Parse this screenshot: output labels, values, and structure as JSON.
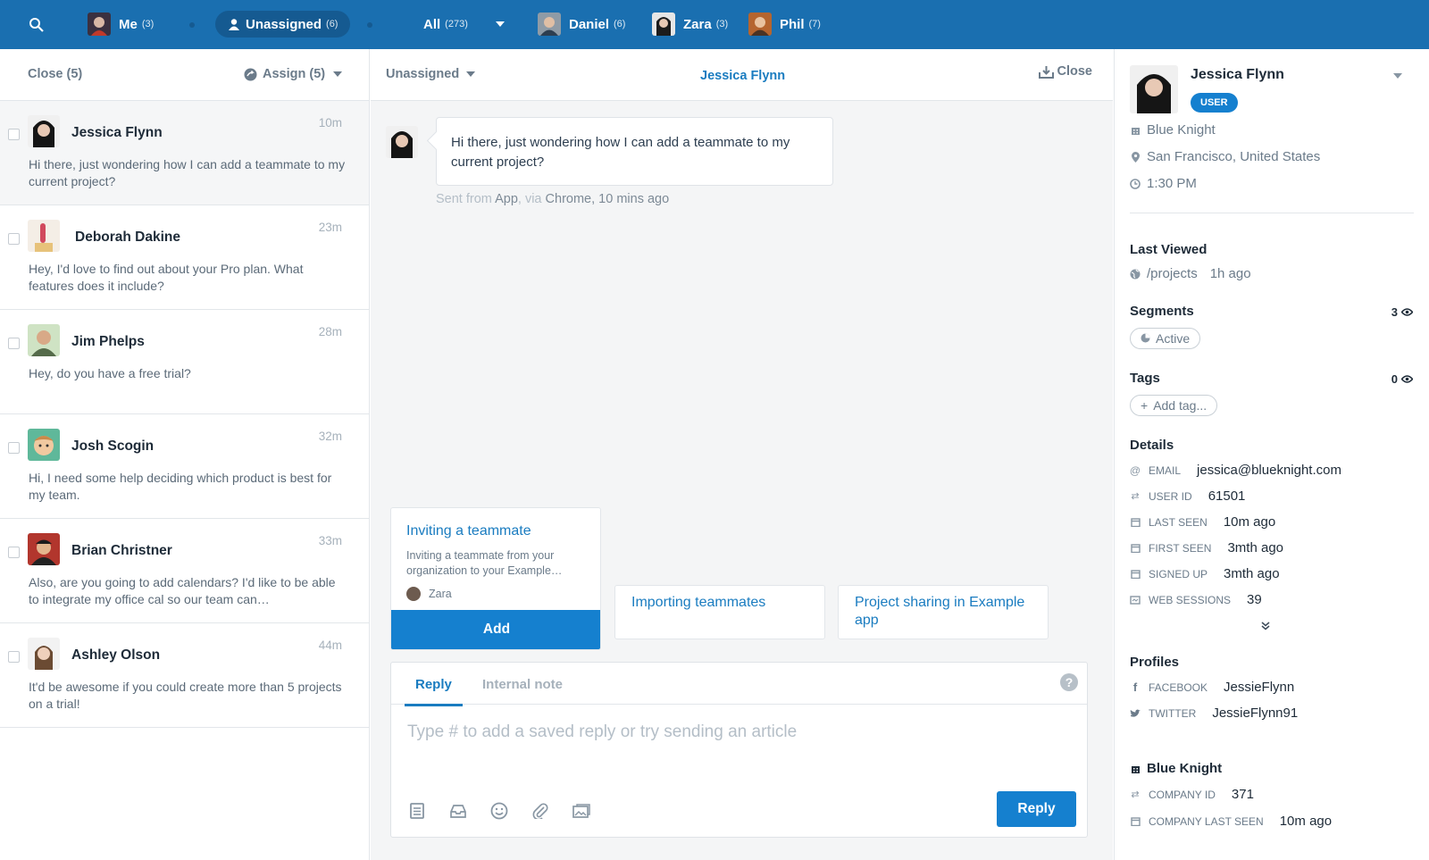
{
  "topbar": {
    "items": [
      {
        "label": "Me",
        "count": "(3)"
      },
      {
        "label": "Unassigned",
        "count": "(6)"
      },
      {
        "label": "All",
        "count": "(273)"
      },
      {
        "label": "Daniel",
        "count": "(6)"
      },
      {
        "label": "Zara",
        "count": "(3)"
      },
      {
        "label": "Phil",
        "count": "(7)"
      }
    ]
  },
  "left_header": {
    "close": "Close (5)",
    "assign": "Assign (5)"
  },
  "conversations": [
    {
      "name": "Jessica Flynn",
      "time": "10m",
      "preview": "Hi there, just wondering how I can add a teammate to my current project?"
    },
    {
      "name": "Deborah Dakine",
      "time": "23m",
      "preview": "Hey, I'd love to find out about your Pro plan. What features does it include?"
    },
    {
      "name": "Jim Phelps",
      "time": "28m",
      "preview": "Hey, do you have a free trial?"
    },
    {
      "name": "Josh Scogin",
      "time": "32m",
      "preview": "Hi, I need some help deciding which product is best for my team."
    },
    {
      "name": "Brian Christner",
      "time": "33m",
      "preview": "Also, are you going to add calendars? I'd like to be able to integrate my office cal so our team can…"
    },
    {
      "name": "Ashley Olson",
      "time": "44m",
      "preview": "It'd be awesome if you could create more than 5 projects on a trial!"
    }
  ],
  "mid_header": {
    "assignee": "Unassigned",
    "customer": "Jessica Flynn",
    "close": "Close"
  },
  "message": {
    "text": "Hi there, just wondering how I can add a teammate to my current project?",
    "meta_sent_from": "Sent from",
    "meta_app": "App",
    "meta_via": ", via",
    "meta_browser": "Chrome",
    "meta_time": ", 10 mins ago"
  },
  "articles": [
    {
      "title": "Inviting a teammate",
      "desc": "Inviting a teammate from your organization to your Example…",
      "author": "Zara",
      "action": "Add"
    },
    {
      "title": "Importing teammates"
    },
    {
      "title": "Project sharing in Example app"
    }
  ],
  "composer": {
    "tab_reply": "Reply",
    "tab_note": "Internal note",
    "help": "?",
    "placeholder": "Type # to add a saved reply or try sending an article",
    "send": "Reply"
  },
  "profile": {
    "name": "Jessica Flynn",
    "badge": "USER",
    "company": "Blue Knight",
    "location": "San Francisco, United States",
    "local_time": "1:30 PM",
    "last_viewed_title": "Last Viewed",
    "last_viewed_page": "/projects",
    "last_viewed_time": "1h ago",
    "segments_title": "Segments",
    "segments_count": "3",
    "segment_chip": "Active",
    "tags_title": "Tags",
    "tags_count": "0",
    "tag_chip": "Add tag...",
    "details_title": "Details",
    "details": [
      {
        "key": "EMAIL",
        "value": "jessica@blueknight.com"
      },
      {
        "key": "USER ID",
        "value": "61501"
      },
      {
        "key": "LAST SEEN",
        "value": "10m ago"
      },
      {
        "key": "FIRST SEEN",
        "value": "3mth ago"
      },
      {
        "key": "SIGNED UP",
        "value": "3mth ago"
      },
      {
        "key": "WEB SESSIONS",
        "value": "39"
      }
    ],
    "profiles_title": "Profiles",
    "profiles": [
      {
        "key": "FACEBOOK",
        "value": "JessieFlynn"
      },
      {
        "key": "TWITTER",
        "value": "JessieFlynn91"
      }
    ],
    "company_title": "Blue Knight",
    "company_details": [
      {
        "key": "COMPANY ID",
        "value": "371"
      },
      {
        "key": "COMPANY LAST SEEN",
        "value": "10m ago"
      }
    ]
  },
  "colors": {
    "brand": "#1a6fb0",
    "accent": "#1580cf",
    "link": "#1a7cc0"
  }
}
